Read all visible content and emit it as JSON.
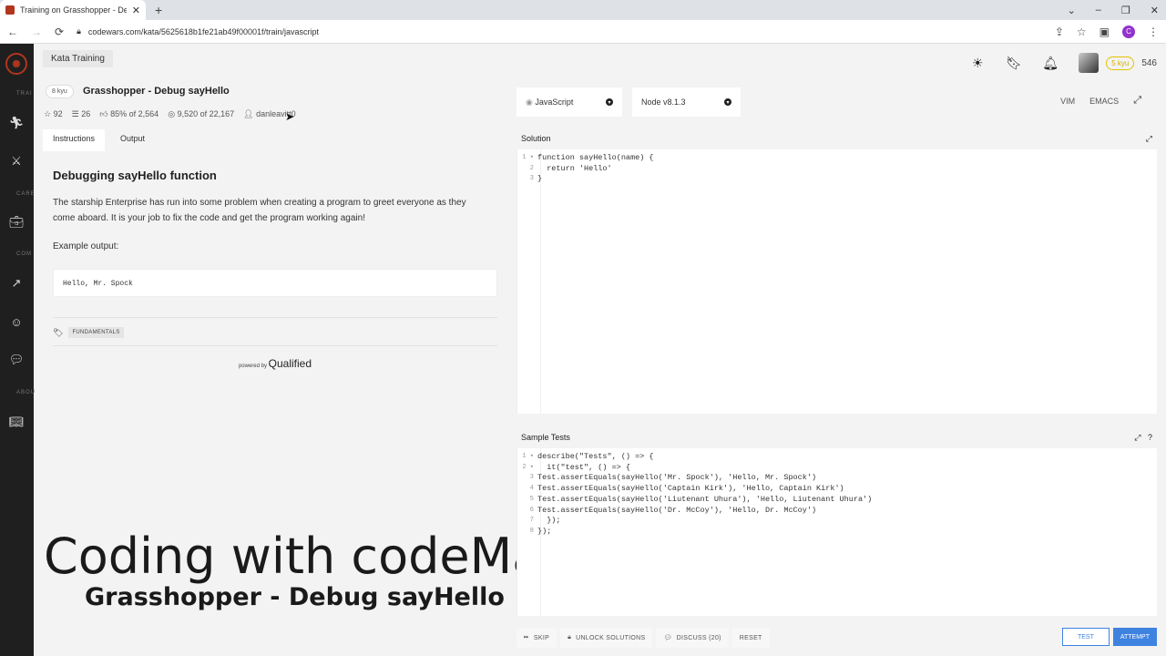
{
  "browser": {
    "tab_title": "Training on Grasshopper - Debu",
    "new_tab": "+",
    "url": "codewars.com/kata/5625618b1fe21ab49f00001f/train/javascript",
    "profile_initial": "C"
  },
  "sidebar": {
    "labels": [
      "TRAI",
      "CARE",
      "COM",
      "ABOU"
    ]
  },
  "header": {
    "kata_training": "Kata Training",
    "rank_badge": "5 kyu",
    "honor": "546"
  },
  "kata": {
    "kyu": "8 kyu",
    "title": "Grasshopper - Debug sayHello",
    "stars": "92",
    "collections": "26",
    "satisfaction": "85% of 2,564",
    "completed": "9,520 of 22,167",
    "author": "danleavitt0"
  },
  "left_tabs": [
    "Instructions",
    "Output"
  ],
  "description": {
    "heading": "Debugging sayHello function",
    "paragraph": "The starship Enterprise has run into some problem when creating a program to greet everyone as they come aboard. It is your job to fix the code and get the program working again!",
    "example_label": "Example output:",
    "example_code": "Hello, Mr. Spock",
    "tag": "FUNDAMENTALS",
    "powered_by": "powered by",
    "brand": "Qualified"
  },
  "editor": {
    "language": "JavaScript",
    "runtime": "Node v8.1.3",
    "mode_vim": "VIM",
    "mode_emacs": "EMACS",
    "solution_title": "Solution",
    "tests_title": "Sample Tests",
    "solution_lines": [
      "function sayHello(name) {",
      "  return 'Hello'",
      "}"
    ],
    "test_lines": [
      "describe(\"Tests\", () => {",
      "  it(\"test\", () => {",
      "Test.assertEquals(sayHello('Mr. Spock'), 'Hello, Mr. Spock')",
      "Test.assertEquals(sayHello('Captain Kirk'), 'Hello, Captain Kirk')",
      "Test.assertEquals(sayHello('Liutenant Uhura'), 'Hello, Liutenant Uhura')",
      "Test.assertEquals(sayHello('Dr. McCoy'), 'Hello, Dr. McCoy')",
      "  });",
      "});"
    ]
  },
  "actions": {
    "skip": "SKIP",
    "unlock": "UNLOCK SOLUTIONS",
    "discuss": "DISCUSS (20)",
    "reset": "RESET",
    "test": "TEST",
    "attempt": "ATTEMPT"
  },
  "overlay": {
    "line1": "Coding with codeManS",
    "line2": "Grasshopper - Debug sayHello"
  }
}
